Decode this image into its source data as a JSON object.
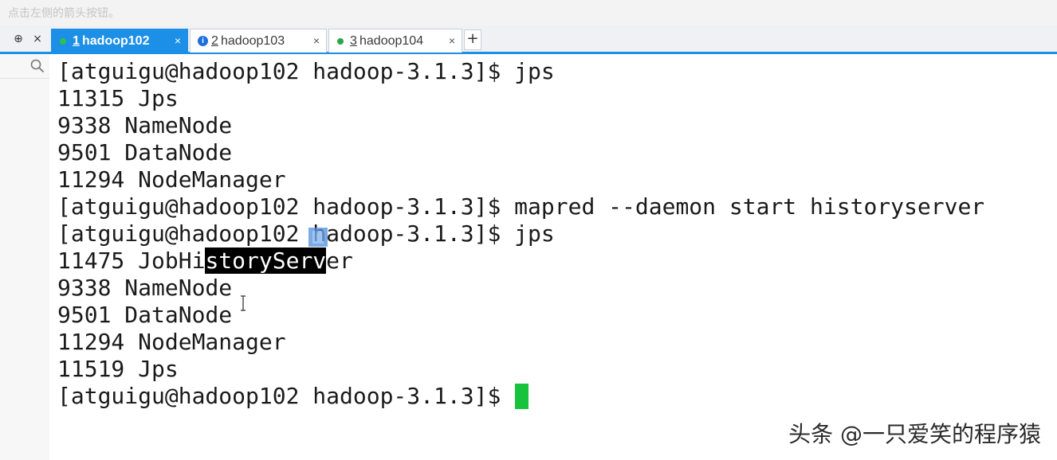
{
  "hint": "点击左侧的箭头按钮。",
  "pane_controls": {
    "pin_icon": "pin-icon",
    "close_icon": "close-icon",
    "pin_glyph": "⊕",
    "close_glyph": "×"
  },
  "tabs": [
    {
      "number": "1",
      "name": "hadoop102",
      "active": true,
      "status": "connected-dot"
    },
    {
      "number": "2",
      "name": "hadoop103",
      "active": false,
      "status": "info-icon"
    },
    {
      "number": "3",
      "name": "hadoop104",
      "active": false,
      "status": "connected-dot"
    }
  ],
  "tab_close_glyph": "×",
  "add_tab_glyph": "+",
  "terminal": {
    "lines": [
      "[atguigu@hadoop102 hadoop-3.1.3]$ jps",
      "11315 Jps",
      "9338 NameNode",
      "9501 DataNode",
      "11294 NodeManager",
      "[atguigu@hadoop102 hadoop-3.1.3]$ mapred --daemon start historyserver",
      "[atguigu@hadoop102 hadoop-3.1.3]$ jps",
      "11475 JobHistoryServer",
      "9338 NameNode",
      "9501 DataNode",
      "11294 NodeManager",
      "11519 Jps",
      "[atguigu@hadoop102 hadoop-3.1.3]$ "
    ],
    "selection": {
      "line": 7,
      "before": "11475 JobHi",
      "selected": "storyServ",
      "after": "er"
    },
    "cursor_color": "#17c33c",
    "selection_color": "#000000"
  },
  "watermark": "头条 @一只爱笑的程序猿",
  "colors": {
    "accent": "#1c8fe6",
    "status_green": "#2aa54a",
    "info_blue": "#1c6fdc"
  }
}
